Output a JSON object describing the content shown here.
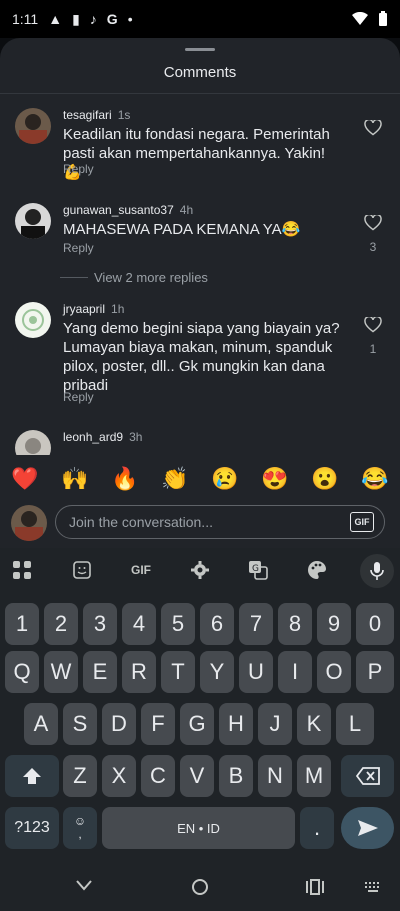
{
  "status": {
    "time": "1:11"
  },
  "sheet": {
    "title": "Comments"
  },
  "comments": [
    {
      "user": "tesagifari",
      "time": "1s",
      "text": "Keadilan itu fondasi negara. Pemerintah pasti akan mempertahankannya. Yakin! 💪",
      "reply": "Reply",
      "likes": ""
    },
    {
      "user": "gunawan_susanto37",
      "time": "4h",
      "text": "MAHASEWA PADA KEMANA YA😂",
      "reply": "Reply",
      "likes": "3"
    },
    {
      "user": "jryaapril",
      "time": "1h",
      "text": "Yang demo begini siapa yang biayain ya? Lumayan biaya makan, minum, spanduk pilox, poster, dll.. Gk mungkin kan dana pribadi",
      "reply": "Reply",
      "likes": "1"
    },
    {
      "user": "leonh_ard9",
      "time": "3h",
      "text": "",
      "reply": "",
      "likes": ""
    }
  ],
  "more_replies": "View 2 more replies",
  "emojis": [
    "❤️",
    "🙌",
    "🔥",
    "👏",
    "😢",
    "😍",
    "😮",
    "😂"
  ],
  "input": {
    "placeholder": "Join the conversation...",
    "gif_label": "GIF"
  },
  "keyboard": {
    "toolbar_gif": "GIF",
    "row_numbers": [
      "1",
      "2",
      "3",
      "4",
      "5",
      "6",
      "7",
      "8",
      "9",
      "0"
    ],
    "row_q": [
      "Q",
      "W",
      "E",
      "R",
      "T",
      "Y",
      "U",
      "I",
      "O",
      "P"
    ],
    "row_a": [
      "A",
      "S",
      "D",
      "F",
      "G",
      "H",
      "J",
      "K",
      "L"
    ],
    "row_z": [
      "Z",
      "X",
      "C",
      "V",
      "B",
      "N",
      "M"
    ],
    "symbols_key": "?123",
    "emoji_key": "☺\n,",
    "space_label": "EN • ID",
    "period_key": "."
  }
}
